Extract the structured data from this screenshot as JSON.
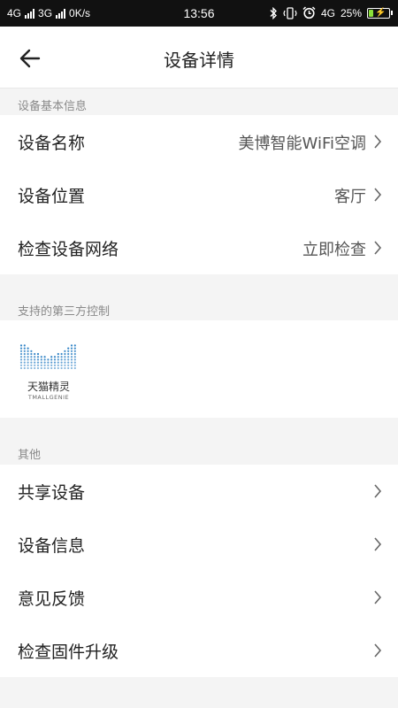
{
  "status_bar": {
    "left_text": "4G",
    "network2": "3G",
    "speed": "0K/s",
    "time": "13:56",
    "network_right": "4G",
    "battery": "25%",
    "battery_level": 0.25,
    "battery_color": "#8be03a",
    "icons": [
      "bluetooth-icon",
      "vibrate-icon",
      "alarm-icon"
    ]
  },
  "header": {
    "title": "设备详情",
    "back_icon": "arrow-left-icon"
  },
  "basic_info": {
    "section_title": "设备基本信息",
    "rows": [
      {
        "label": "设备名称",
        "value": "美博智能WiFi空调"
      },
      {
        "label": "设备位置",
        "value": "客厅"
      },
      {
        "label": "检查设备网络",
        "value": "立即检查"
      }
    ]
  },
  "third_party": {
    "section_title": "支持的第三方控制",
    "tmall_name": "天猫精灵",
    "tmall_sub": "TMALLGENIE",
    "logo_color": "#2a7fc4"
  },
  "other": {
    "section_title": "其他",
    "rows": [
      {
        "label": "共享设备"
      },
      {
        "label": "设备信息"
      },
      {
        "label": "意见反馈"
      },
      {
        "label": "检查固件升级"
      }
    ]
  }
}
